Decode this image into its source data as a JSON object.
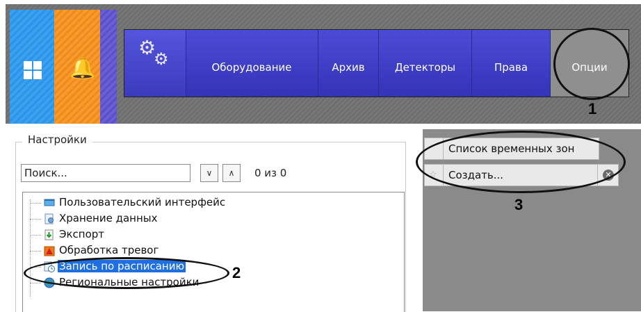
{
  "topbar": {
    "nav": [
      {
        "label": "Оборудование"
      },
      {
        "label": "Архив"
      },
      {
        "label": "Детекторы"
      },
      {
        "label": "Права"
      },
      {
        "label": "Опции"
      }
    ]
  },
  "callouts": [
    "1",
    "2",
    "3"
  ],
  "settings": {
    "title": "Настройки",
    "search_value": "Поиск...",
    "down_arrow": "∨",
    "up_arrow": "∧",
    "result_count": "0 из 0",
    "tree": [
      {
        "label": "Пользовательский интерфейс",
        "icon": "monitor-icon"
      },
      {
        "label": "Хранение данных",
        "icon": "storage-icon"
      },
      {
        "label": "Экспорт",
        "icon": "export-icon"
      },
      {
        "label": "Обработка тревог",
        "icon": "alarm-icon"
      },
      {
        "label": "Запись по расписанию",
        "icon": "schedule-icon",
        "selected": true
      },
      {
        "label": "Региональные настройки",
        "icon": "globe-icon"
      }
    ]
  },
  "timezones": {
    "header": "Список временных зон",
    "create_label": "Создать..."
  },
  "colors": {
    "home_tile": "#2d93e6",
    "alert_tile": "#f08a1a",
    "nav_bar": "#3d3dc4",
    "selection": "#1f6fe0"
  }
}
